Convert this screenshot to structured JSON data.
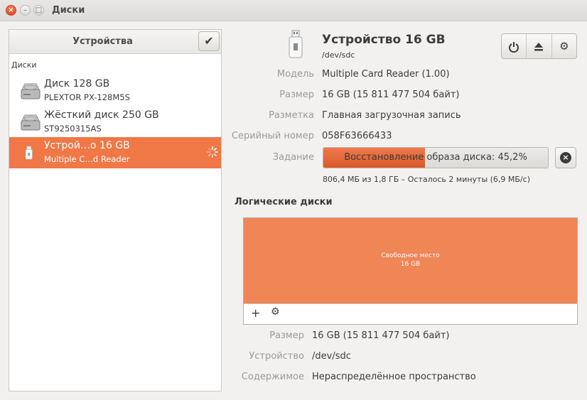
{
  "window": {
    "title": "Диски"
  },
  "sidebar": {
    "header_title": "Устройства",
    "section_label": "Диски",
    "devices": [
      {
        "name": "Диск 128 GB",
        "subtitle": "PLEXTOR PX-128M5S"
      },
      {
        "name": "Жёсткий диск 250 GB",
        "subtitle": "ST9250315AS"
      },
      {
        "name": "Устрой…о 16 GB",
        "subtitle": "Multiple C…d  Reader"
      }
    ]
  },
  "device": {
    "title": "Устройство 16 GB",
    "path": "/dev/sdc",
    "properties": {
      "model_label": "Модель",
      "model": "Multiple Card  Reader (1.00)",
      "size_label": "Размер",
      "size": "16 GB (15 811 477 504 байт)",
      "partitioning_label": "Разметка",
      "partitioning": "Главная загрузочная запись",
      "serial_label": "Серийный номер",
      "serial": "058F63666433",
      "job_label": "Задание"
    },
    "job": {
      "text": "Восстановление образа диска: 45,2%",
      "progress": 0.452,
      "status": "806,4 МБ из 1,8 ГБ – Осталось 2 минуты (6,9 МБ/с)"
    }
  },
  "volumes": {
    "title": "Логические диски",
    "free_label": "Свободное место",
    "free_size": "16 GB",
    "properties": {
      "size_label": "Размер",
      "size": "16 GB (15 811 477 504 байт)",
      "device_label": "Устройство",
      "device": "/dev/sdc",
      "contents_label": "Содержимое",
      "contents": "Нераспределённое пространство"
    }
  },
  "colors": {
    "accent": "#f07746",
    "free_space": "#f08556"
  }
}
